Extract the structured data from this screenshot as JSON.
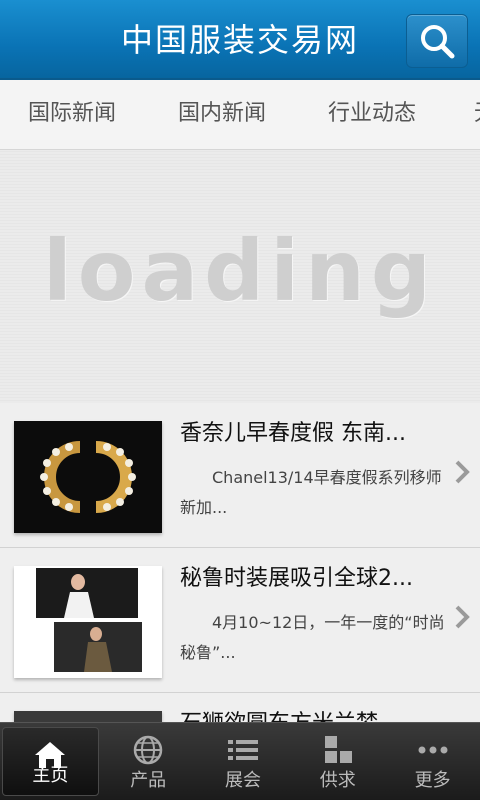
{
  "header": {
    "title": "中国服装交易网"
  },
  "tabs": [
    {
      "label": "国际新闻"
    },
    {
      "label": "国内新闻"
    },
    {
      "label": "行业动态"
    },
    {
      "label": "无"
    }
  ],
  "banner": {
    "text": "loading"
  },
  "news": [
    {
      "title": "香奈儿早春度假 东南...",
      "desc": "Chanel13/14早春度假系列移师新加..."
    },
    {
      "title": "秘鲁时装展吸引全球2...",
      "desc": "4月10~12日，一年一度的“时尚秘鲁”..."
    },
    {
      "title": "石狮欲圆东方米兰梦",
      "desc": ""
    }
  ],
  "bottom_nav": [
    {
      "label": "主页",
      "icon": "home-icon"
    },
    {
      "label": "产品",
      "icon": "globe-icon"
    },
    {
      "label": "展会",
      "icon": "list-icon"
    },
    {
      "label": "供求",
      "icon": "blocks-icon"
    },
    {
      "label": "更多",
      "icon": "more-icon"
    }
  ]
}
